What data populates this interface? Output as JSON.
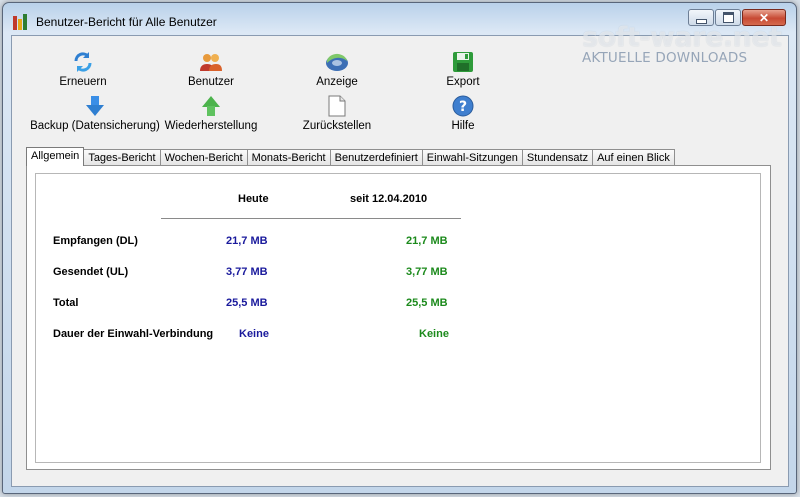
{
  "window": {
    "title": "Benutzer-Bericht für Alle Benutzer"
  },
  "toolbar": {
    "refresh": "Erneuern",
    "users": "Benutzer",
    "display": "Anzeige",
    "export": "Export",
    "backup": "Backup (Datensicherung)",
    "restore": "Wiederherstellung",
    "reset": "Zurückstellen",
    "help": "Hilfe"
  },
  "tabs": [
    "Allgemein",
    "Tages-Bericht",
    "Wochen-Bericht",
    "Monats-Bericht",
    "Benutzerdefiniert",
    "Einwahl-Sitzungen",
    "Stundensatz",
    "Auf einen Blick"
  ],
  "report": {
    "col_today": "Heute",
    "col_since": "seit 12.04.2010",
    "rows": [
      {
        "label": "Empfangen (DL)",
        "today": "21,7 MB",
        "since": "21,7 MB"
      },
      {
        "label": "Gesendet (UL)",
        "today": "3,77 MB",
        "since": "3,77 MB"
      },
      {
        "label": "Total",
        "today": "25,5 MB",
        "since": "25,5 MB"
      },
      {
        "label": "Dauer der Einwahl-Verbindung",
        "today": "Keine",
        "since": "Keine"
      }
    ]
  },
  "watermark": {
    "logo": "soft-ware.net",
    "tagline": "AKTUELLE DOWNLOADS"
  },
  "colors": {
    "today_value": "#1a1a9c",
    "since_value": "#1c8a1c"
  }
}
